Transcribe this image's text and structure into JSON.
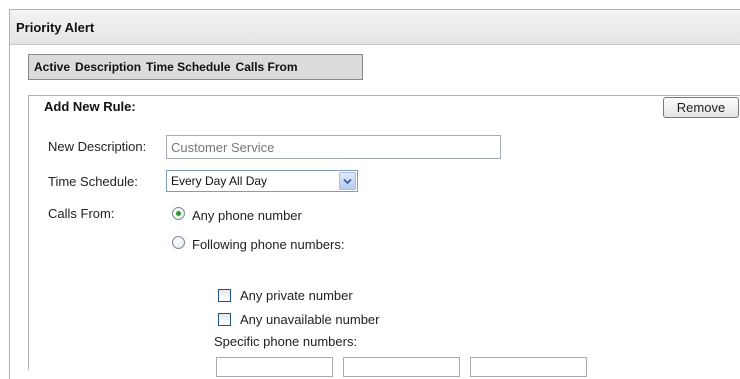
{
  "panel": {
    "title": "Priority Alert"
  },
  "columns": [
    "Active",
    "Description",
    "Time Schedule",
    "Calls From"
  ],
  "rule": {
    "title": "Add New Rule:",
    "remove_label": "Remove",
    "description_label": "New Description:",
    "description_value": "Customer Service",
    "schedule_label": "Time Schedule:",
    "schedule_value": "Every Day All Day",
    "calls_from_label": "Calls From:",
    "options": {
      "any_number": "Any phone number",
      "following_numbers": "Following phone numbers:"
    },
    "selected_option": "any_number",
    "checkboxes": {
      "private_number": "Any private number",
      "unavailable_number": "Any unavailable number"
    },
    "specific_numbers_label": "Specific phone numbers:",
    "specific_numbers": [
      "",
      "",
      ""
    ]
  },
  "colors": {
    "radio_selected": "#2a9a2a",
    "checkbox_border": "#1c5180",
    "header_background": "#dcdcdc"
  },
  "icons": {
    "select_arrow": "chevron-down-icon"
  }
}
